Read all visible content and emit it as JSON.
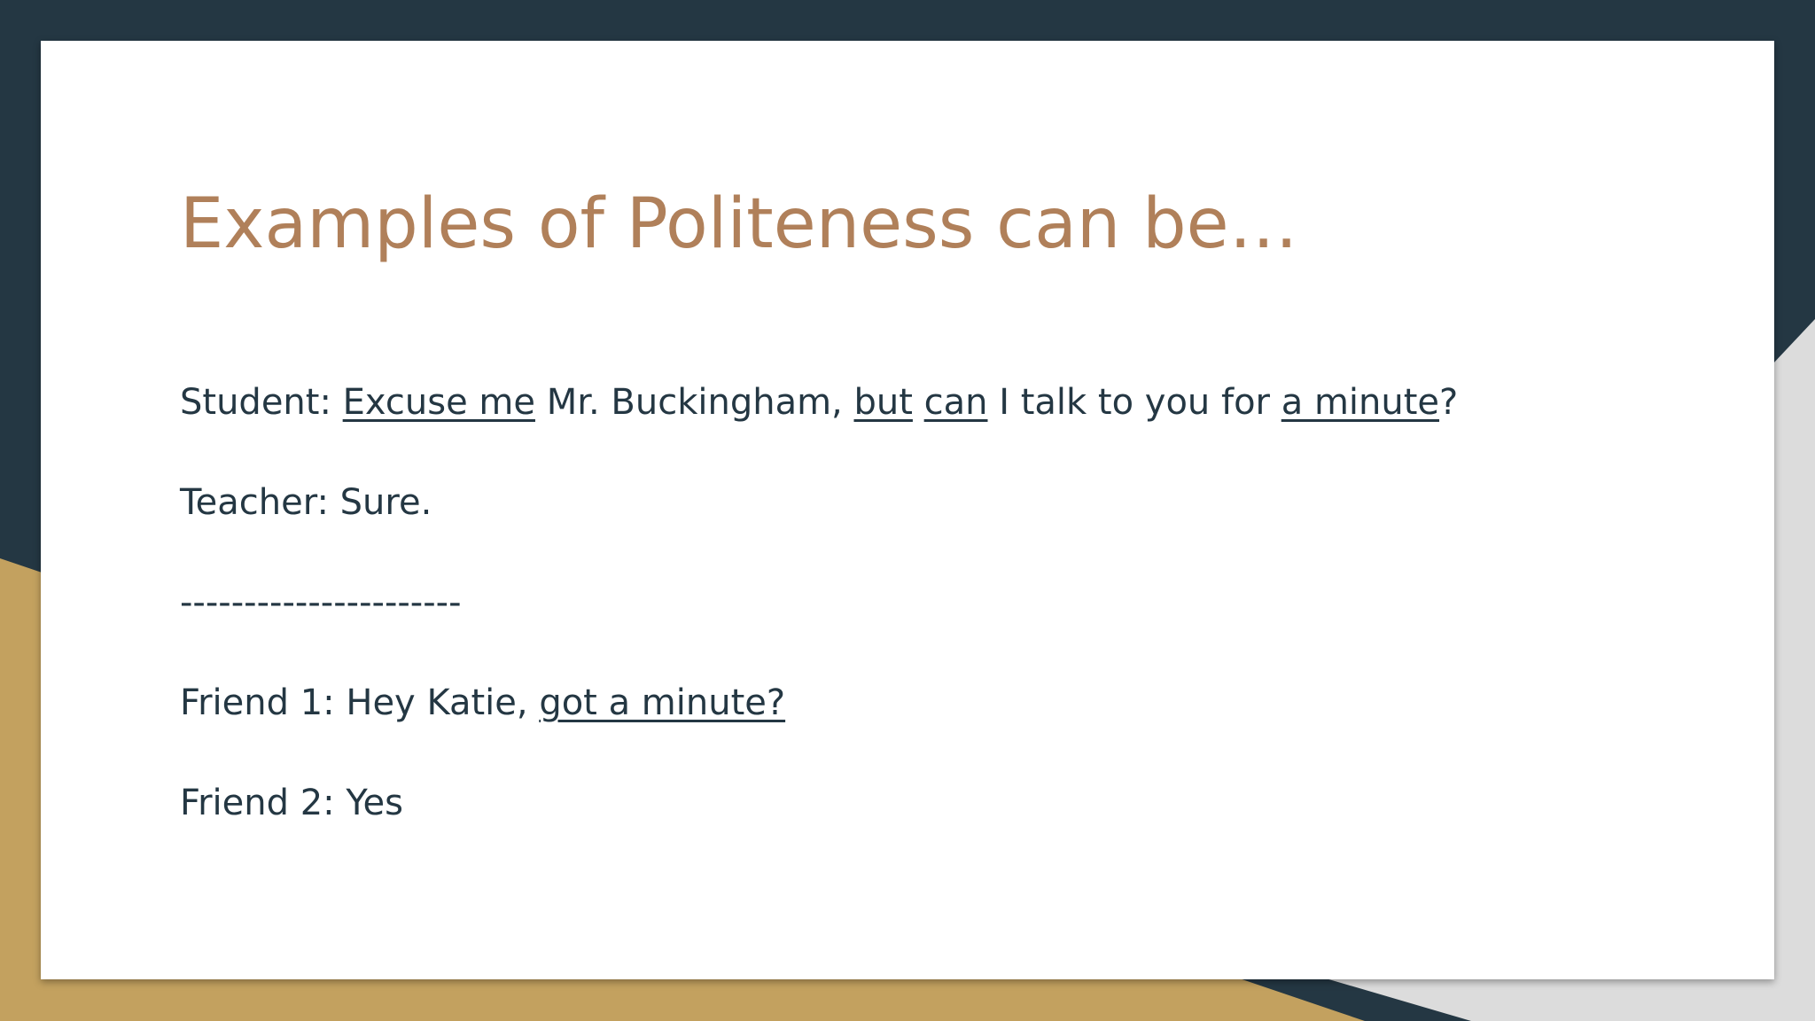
{
  "theme": {
    "dark": "#243743",
    "gold": "#c3a15f",
    "grey": "#dcdcdc",
    "title_color": "#b0805a",
    "text_color": "#243743"
  },
  "slide": {
    "title": "Examples of Politeness can be…",
    "lines": [
      {
        "segments": [
          {
            "text": "Student: ",
            "underline": false
          },
          {
            "text": "Excuse me",
            "underline": true
          },
          {
            "text": " Mr. Buckingham, ",
            "underline": false
          },
          {
            "text": "but",
            "underline": true
          },
          {
            "text": " ",
            "underline": false
          },
          {
            "text": "can",
            "underline": true
          },
          {
            "text": " I talk to you for ",
            "underline": false
          },
          {
            "text": "a minute",
            "underline": true
          },
          {
            "text": "?",
            "underline": false
          }
        ]
      },
      {
        "segments": [
          {
            "text": "Teacher: Sure.",
            "underline": false
          }
        ]
      },
      {
        "segments": [
          {
            "text": "----------------------",
            "underline": false
          }
        ]
      },
      {
        "segments": [
          {
            "text": "Friend 1: Hey Katie, ",
            "underline": false
          },
          {
            "text": "got a minute?",
            "underline": true
          }
        ]
      },
      {
        "segments": [
          {
            "text": "Friend 2: Yes",
            "underline": false
          }
        ]
      }
    ]
  }
}
